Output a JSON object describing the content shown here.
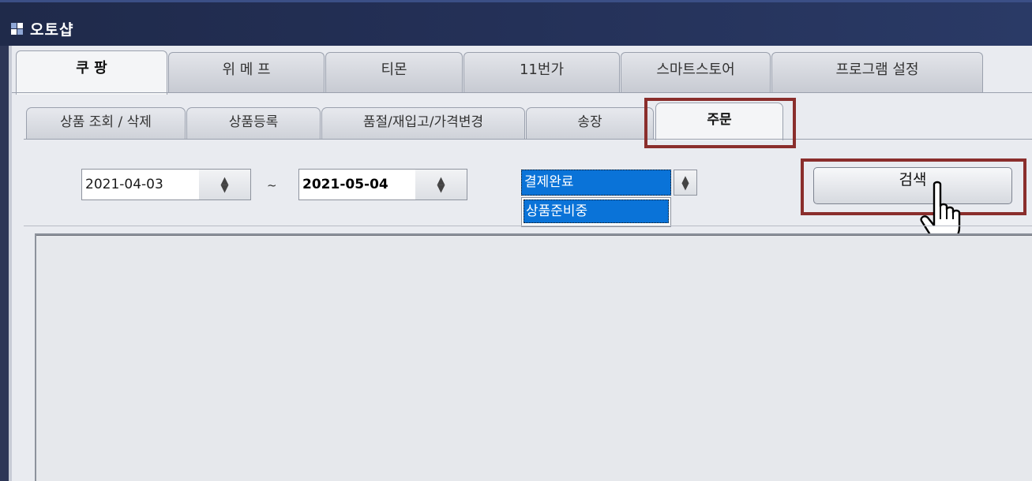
{
  "window": {
    "title": "오토샵"
  },
  "main_tabs": [
    {
      "label": "쿠 팡",
      "active": true
    },
    {
      "label": "위 메 프"
    },
    {
      "label": "티몬"
    },
    {
      "label": "11번가"
    },
    {
      "label": "스마트스토어"
    },
    {
      "label": "프로그램 설정"
    }
  ],
  "sub_tabs": [
    {
      "label": "상품 조회 / 삭제"
    },
    {
      "label": "상품등록"
    },
    {
      "label": "품절/재입고/가격변경"
    },
    {
      "label": "송장"
    },
    {
      "label": "주문",
      "active": true
    }
  ],
  "order_filter": {
    "start_date": "2021-04-03",
    "separator": "~",
    "end_date": "2021-05-04",
    "status_selected": "결제완료",
    "status_options": [
      "상품준비중"
    ],
    "search_label": "검색"
  },
  "colors": {
    "highlight": "#8a2e2c",
    "selection": "#0a73d8",
    "titlebar": "#1f2a4a"
  },
  "icons": {
    "spinner": "up-down-arrows",
    "cursor": "hand-pointer"
  }
}
